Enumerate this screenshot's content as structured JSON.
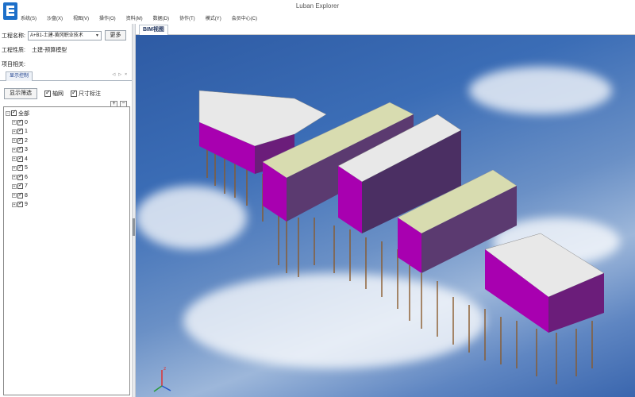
{
  "window": {
    "title": "Luban Explorer"
  },
  "menu": [
    "系统(S)",
    "沙盘(X)",
    "视图(V)",
    "操作(O)",
    "资料(M)",
    "数据(D)",
    "协作(T)",
    "模式(Y)",
    "会员中心(C)"
  ],
  "project": {
    "name_label": "工程名称:",
    "name_value": "A+B1-土建-黄冈职业技术",
    "more_label": "更多",
    "nature_label": "工程性质:",
    "nature_value": "土建-预算模型",
    "related_label": "项目相关:"
  },
  "tabs": {
    "display_control": "显示控制",
    "nav": [
      "◁",
      "▷",
      "×"
    ]
  },
  "controls": {
    "filter_label": "显示筛选",
    "axis_label": "轴网",
    "dim_label": "尺寸标注",
    "plus": "+",
    "minus": "−"
  },
  "tree": {
    "root": "全部",
    "items": [
      "0",
      "1",
      "2",
      "3",
      "4",
      "5",
      "6",
      "7",
      "8",
      "9"
    ]
  },
  "view": {
    "tab_label": "BIM视图"
  },
  "colors": {
    "facade": "#a800b0",
    "roof": "#e9e9e9",
    "sky": "#3b6db6",
    "piles": "#8a5a2b"
  }
}
